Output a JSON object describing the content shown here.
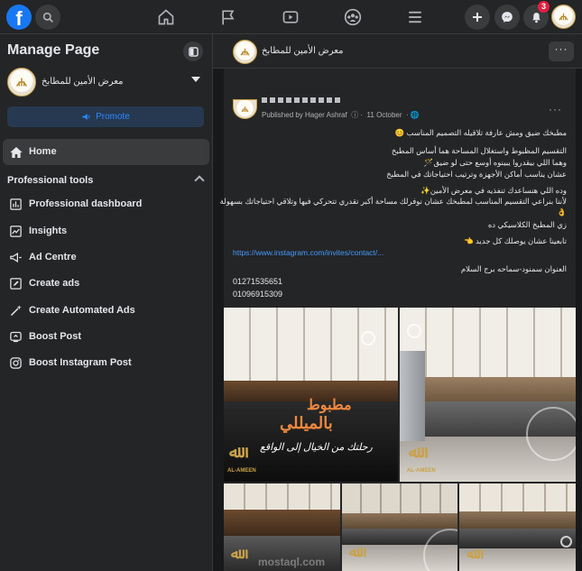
{
  "topbar": {
    "logo_letter": "f",
    "notifications_count": "3"
  },
  "sidebar": {
    "title": "Manage Page",
    "page_name": "معرض الأمين للمطابخ",
    "promote_label": "Promote",
    "home_label": "Home",
    "section_title": "Professional tools",
    "tools": [
      {
        "label": "Professional dashboard",
        "icon": "dashboard-icon"
      },
      {
        "label": "Insights",
        "icon": "insights-icon"
      },
      {
        "label": "Ad Centre",
        "icon": "megaphone-icon"
      },
      {
        "label": "Create ads",
        "icon": "pencil-icon"
      },
      {
        "label": "Create Automated Ads",
        "icon": "magic-wand-icon"
      },
      {
        "label": "Boost Post",
        "icon": "boost-icon"
      },
      {
        "label": "Boost Instagram Post",
        "icon": "instagram-icon"
      }
    ]
  },
  "page_header": {
    "page_name": "معرض الأمين للمطابخ"
  },
  "post": {
    "published_by": "Published by Hager Ashraf",
    "date": "11 October",
    "lines": [
      "مطبخك ضيق ومش عارفة تلاقيله التصميم المناسب 😊",
      "التقسيم المظبوط واستغلال المساحة هما أساس المطبخ",
      "وهما اللي بيقدروا يبينوه أوسع حتى لو ضيق🪄",
      "عشان يناسب أماكن الأجهزة وترتيب احتياجاتك في المطبخ",
      "وده اللي هنساعدك تنفذيه في معرض الأمين✨",
      "لأننا بنراعي التقسيم المناسب لمطبخك عشان نوفرلك مساحة أكبر تقدري تتحركي فيها وتلاقي احتياجاتك بسهولة",
      "👌",
      "زي المطبخ الكلاسيكي ده",
      "تابعينا عشان يوصلك كل جديد 👈",
      "العنوان سمنود-سماحه برج السلام"
    ],
    "link": "https://www.instagram.com/invites/contact/...",
    "phones": [
      "01271535651",
      "01096915309"
    ]
  },
  "photos": {
    "overlay_title_line1": "مطبوط",
    "overlay_title_line2": "بالميللي",
    "overlay_tagline": "رحلتك من الخيال إلى الواقع",
    "brand": "AL-AMEEN",
    "watermark": "mostaql.com"
  }
}
